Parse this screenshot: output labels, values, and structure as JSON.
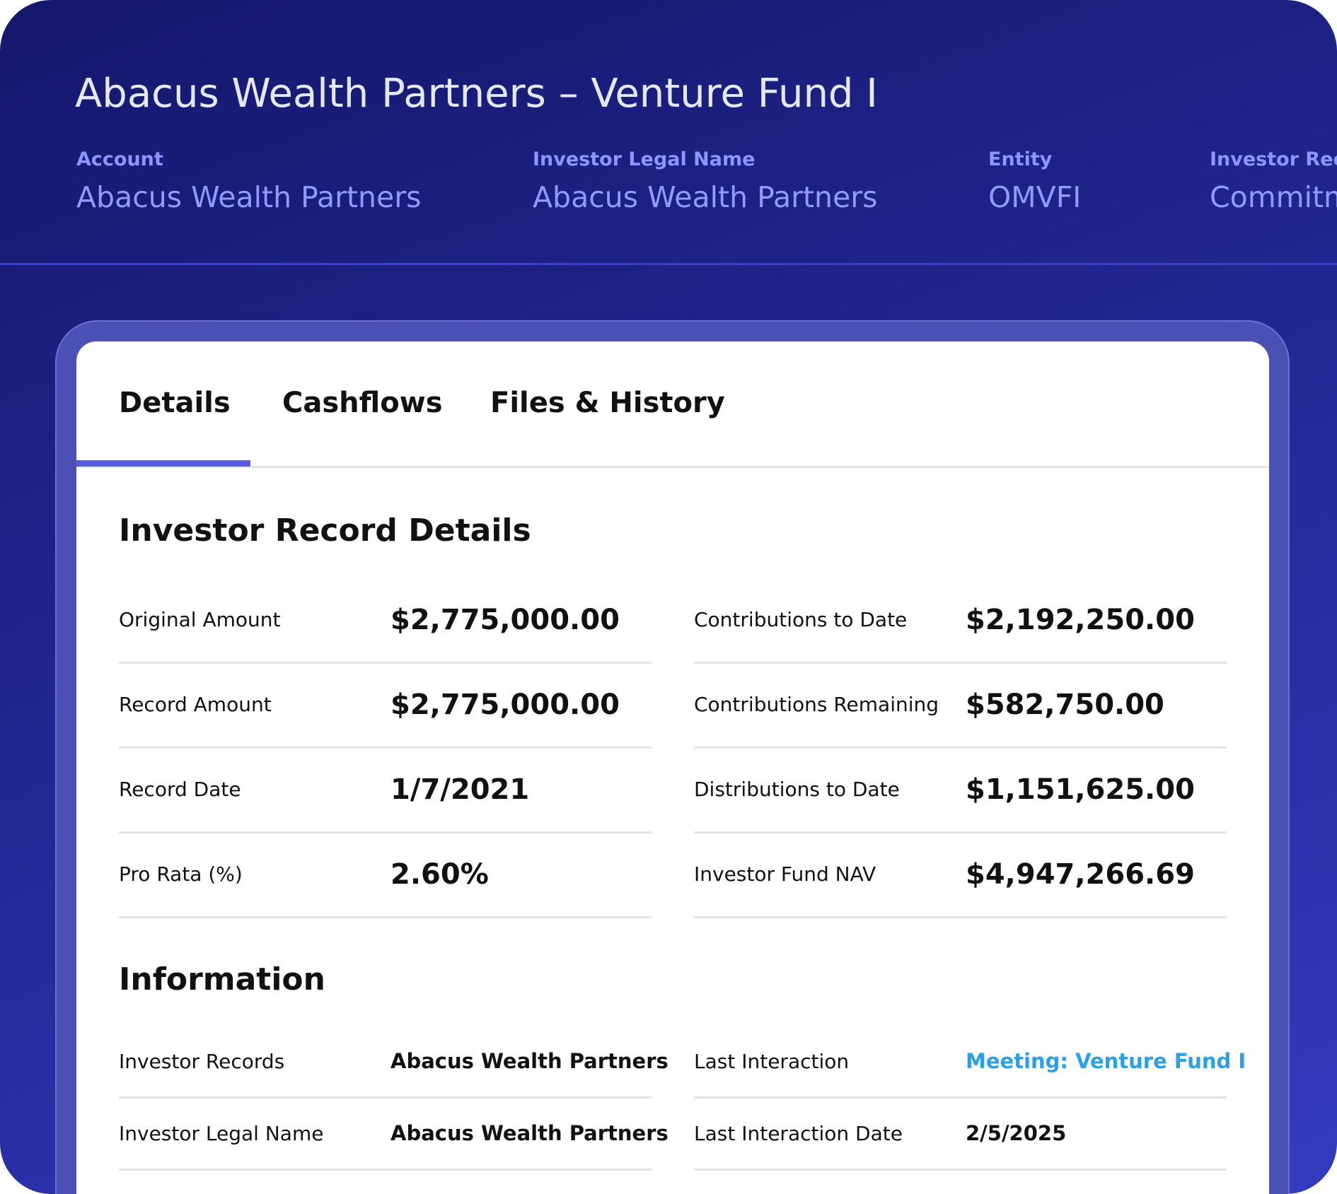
{
  "header": {
    "title": "Abacus Wealth Partners – Venture Fund I",
    "meta": [
      {
        "label": "Account",
        "value": "Abacus Wealth Partners"
      },
      {
        "label": "Investor Legal Name",
        "value": "Abacus Wealth Partners"
      },
      {
        "label": "Entity",
        "value": "OMVFI"
      },
      {
        "label": "Investor Rec",
        "value": "Commitm"
      }
    ]
  },
  "tabs": [
    {
      "label": "Details",
      "active": true
    },
    {
      "label": "Cashflows",
      "active": false
    },
    {
      "label": "Files & History",
      "active": false
    }
  ],
  "record_details": {
    "title": "Investor Record Details",
    "left": [
      {
        "label": "Original Amount",
        "value": "$2,775,000.00"
      },
      {
        "label": "Record Amount",
        "value": "$2,775,000.00"
      },
      {
        "label": "Record Date",
        "value": "1/7/2021"
      },
      {
        "label": "Pro Rata (%)",
        "value": "2.60%"
      }
    ],
    "right": [
      {
        "label": "Contributions to Date",
        "value": "$2,192,250.00"
      },
      {
        "label": "Contributions Remaining",
        "value": "$582,750.00"
      },
      {
        "label": "Distributions to Date",
        "value": "$1,151,625.00"
      },
      {
        "label": "Investor Fund NAV",
        "value": "$4,947,266.69"
      }
    ]
  },
  "information": {
    "title": "Information",
    "left": [
      {
        "label": "Investor Records",
        "value": "Abacus Wealth Partners"
      },
      {
        "label": "Investor Legal Name",
        "value": "Abacus Wealth Partners"
      }
    ],
    "right": [
      {
        "label": "Last Interaction",
        "value": "Meeting: Venture Fund I"
      },
      {
        "label": "Last Interaction Date",
        "value": "2/5/2025"
      }
    ]
  },
  "colors": {
    "header_bg": "#1f2388",
    "tab_indicator": "#5a5ce0",
    "link": "#2aa0e6",
    "meta_label": "#8d95ff"
  }
}
